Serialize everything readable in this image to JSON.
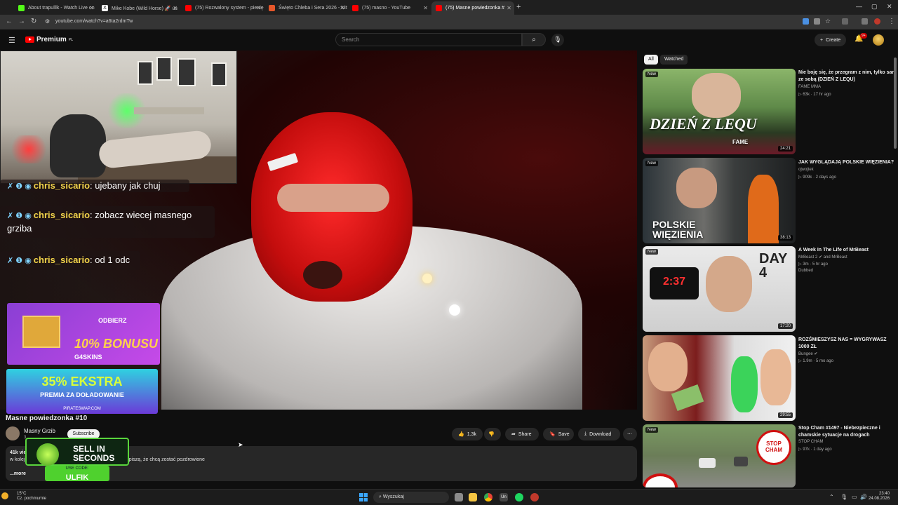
{
  "browser": {
    "tabs": [
      {
        "title": "About trapulllk - Watch Live on",
        "color": "#53fc18"
      },
      {
        "title": "Mike Kobe (Wild Horse) 🚀 us",
        "color": "#ffffff"
      },
      {
        "title": "(75) Rozwalony system - pienię",
        "color": "#ff0000"
      },
      {
        "title": "Święto Chleba i Sera 2026 - Nit",
        "color": "#e6572a"
      },
      {
        "title": "(75) masno - YouTube",
        "color": "#ff0000"
      },
      {
        "title": "(75) Masne powiedzonka #",
        "color": "#ff0000"
      }
    ],
    "url": "youtube.com/watch?v=a6ta2rdmTw"
  },
  "youtube": {
    "logo_text": "Premium",
    "logo_super": "PL",
    "search_placeholder": "Search",
    "create_label": "Create",
    "notif_badge": "9+"
  },
  "overlay": {
    "chat": [
      {
        "user": "chris_sicario",
        "text": "ujebany jak chuj"
      },
      {
        "user": "chris_sicario",
        "text": "zobacz wiecej masnego grziba"
      },
      {
        "user": "chris_sicario",
        "text": "od 1 odc"
      }
    ],
    "ad1": {
      "cta": "ODBIERZ",
      "bonus": "10% BONUSU",
      "brand": "G4SKINS"
    },
    "ad2": {
      "big": "35% EKSTRA",
      "sub": "PREMIA ZA DOŁADOWANIE",
      "site": "PIRATESWAP.COM"
    },
    "ad3": {
      "line1": "SELL IN",
      "line2": "SECONDS",
      "code_label": "USE CODE:",
      "code": "ULFIK"
    }
  },
  "video": {
    "title": "Masne powiedzonka #10",
    "channel": "Masny Grzib",
    "subs": "3",
    "subscribe_label": "Subscribe",
    "likes": "1.3k",
    "share_label": "Share",
    "save_label": "Save",
    "download_label": "Download",
    "views": "41k vie",
    "desc_start": "w kolej",
    "desc_after": "napiszą, że chcą zostać pozdrowione",
    "more_label": "...more"
  },
  "sidebar": {
    "chips": [
      "All",
      "Watched"
    ],
    "recs": [
      {
        "title": "Nie boję się, że przegram z nim, tylko sam ze sobą (DZIEŃ Z LEQU)",
        "channel": "FAME MMA",
        "meta": "▷ 63k · 17 hr ago",
        "extra": "",
        "duration": "24:21",
        "new": "New",
        "thumb_text": "DZIEŃ Z LEQU",
        "thumb_sub": "FAME"
      },
      {
        "title": "JAK WYGLĄDAJĄ POLSKIE WIĘZIENIA?",
        "channel": "ojwojtek",
        "meta": "▷ 909k · 2 days ago",
        "extra": "",
        "duration": "38:13",
        "new": "New",
        "thumb_text": "POLSKIE WIĘZIENIA",
        "thumb_sub": ""
      },
      {
        "title": "A Week In The Life of MrBeast",
        "channel": "MrBeast 2 ✔ and MrBeast",
        "meta": "▷ 3m · 5 hr ago",
        "extra": "Dubbed",
        "duration": "17:20",
        "new": "New",
        "thumb_text": "DAY 4",
        "thumb_sub": "2:37"
      },
      {
        "title": "ROZŚMIESZYSZ NAS = WYGRYWASZ 1000 ZŁ",
        "channel": "Bungee ✔",
        "meta": "▷ 1.9m · 5 mo ago",
        "extra": "",
        "duration": "29:55",
        "new": "",
        "thumb_text": "",
        "thumb_sub": ""
      },
      {
        "title": "Stop Cham #1497 - Niebezpieczne i chamskie sytuacje na drogach",
        "channel": "STOP CHAM",
        "meta": "▷ 97k · 1 day ago",
        "extra": "",
        "duration": "",
        "new": "New",
        "thumb_text": "STOP CHAM",
        "thumb_sub": ""
      }
    ]
  },
  "taskbar": {
    "weather_temp": "15°C",
    "weather_desc": "Cz. pochmurnie",
    "search": "Wyszukaj",
    "time": "23:40",
    "date": "24.08.2026"
  },
  "colors": {
    "accent": "#ff0000",
    "bg": "#0f0f0f"
  }
}
